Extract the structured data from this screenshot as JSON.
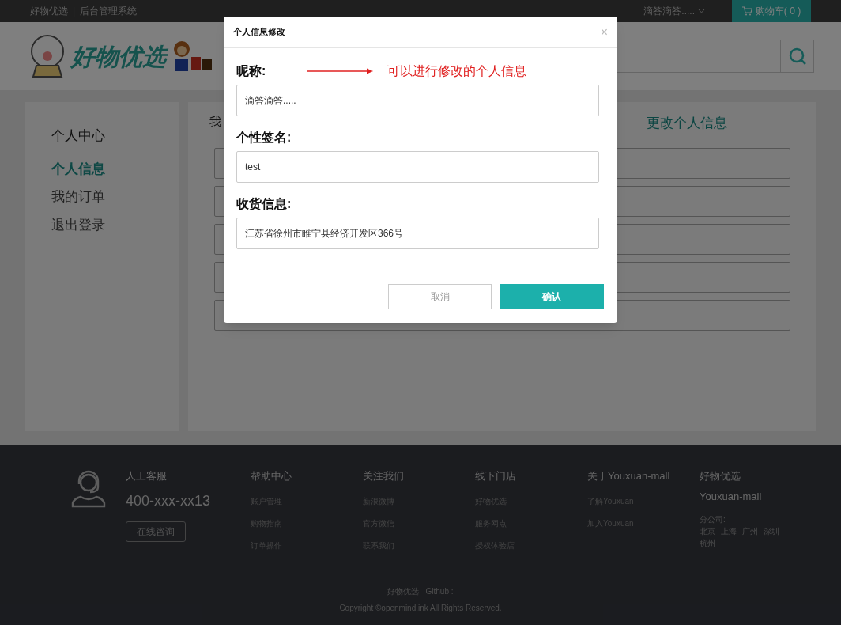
{
  "top_bar": {
    "site": "好物优选",
    "separator": "|",
    "subtitle": "后台管理系统",
    "user": "滴答滴答.....",
    "cart": "购物车( 0 )"
  },
  "header": {
    "logo_text": "好物优选"
  },
  "sidebar": {
    "title": "个人中心",
    "items": [
      {
        "label": "个人信息",
        "selected": true
      },
      {
        "label": "我的订单",
        "selected": false
      },
      {
        "label": "退出登录",
        "selected": false
      }
    ]
  },
  "main": {
    "left_title": "我",
    "right_title": "更改个人信息"
  },
  "dialog": {
    "title": "个人信息修改",
    "close": "×",
    "annotation": "可以进行修改的个人信息",
    "fields": [
      {
        "label": "昵称:",
        "value": "滴答滴答....."
      },
      {
        "label": "个性签名:",
        "value": "test"
      },
      {
        "label": "收货信息:",
        "value": "江苏省徐州市睢宁县经济开发区366号"
      }
    ],
    "cancel": "取消",
    "confirm": "确认"
  },
  "footer": {
    "service": {
      "title": "人工客服",
      "phone": "400-xxx-xx13",
      "button": "在线咨询"
    },
    "columns": [
      {
        "title": "帮助中心",
        "links": [
          "账户管理",
          "购物指南",
          "订单操作"
        ]
      },
      {
        "title": "关注我们",
        "links": [
          "新浪微博",
          "官方微信",
          "联系我们"
        ]
      },
      {
        "title": "线下门店",
        "links": [
          "好物优选",
          "服务网点",
          "授权体验店"
        ]
      },
      {
        "title": "关于Youxuan-mall",
        "links": [
          "了解Youxuan",
          "加入Youxuan"
        ]
      }
    ],
    "brand": {
      "title": "好物优选",
      "subtitle": "Youxuan-mall",
      "branch_label": "分公司:",
      "cities": [
        "北京",
        "上海",
        "广州",
        "深圳",
        "杭州"
      ]
    },
    "bottom_links": [
      "好物优选",
      "Github :"
    ],
    "copyright": "Copyright ©openmind.ink All Rights Reserved."
  }
}
